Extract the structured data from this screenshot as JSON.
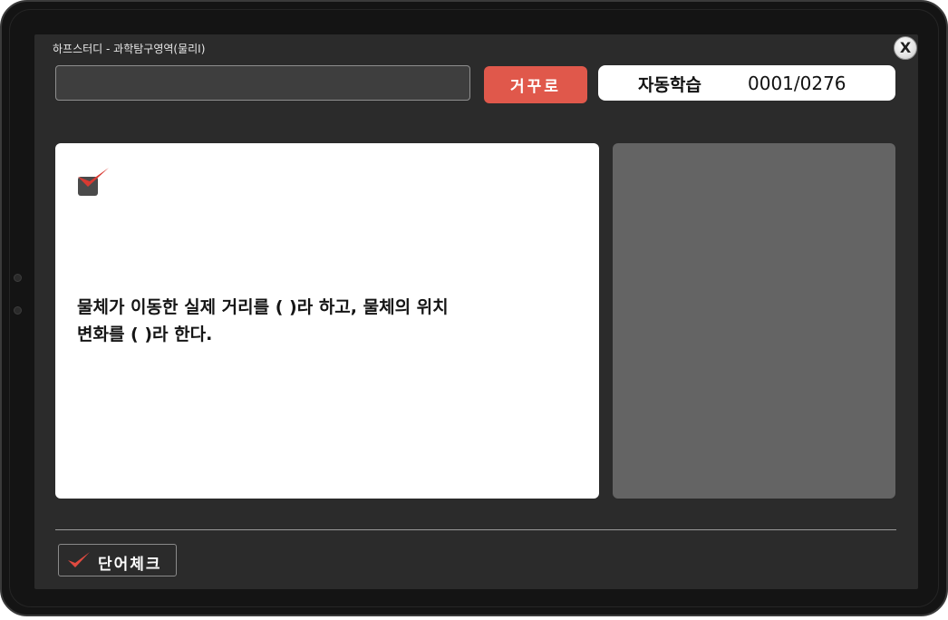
{
  "window": {
    "title": "하프스터디 - 과학탐구영역(물리I)",
    "close_label": "X"
  },
  "toolbar": {
    "search_value": "",
    "reverse_label": "거꾸로",
    "auto_study_label": "자동학습",
    "counter": "0001/0276"
  },
  "question": {
    "text": "물체가 이동한 실제 거리를 ( )라 하고, 물체의 위치\n변화를 ( )라 한다."
  },
  "footer": {
    "word_check_label": "단어체크"
  },
  "colors": {
    "accent_red": "#e0584b",
    "check_red": "#d93a32",
    "screen_bg": "#2b2b2b",
    "answer_panel": "#646464"
  }
}
